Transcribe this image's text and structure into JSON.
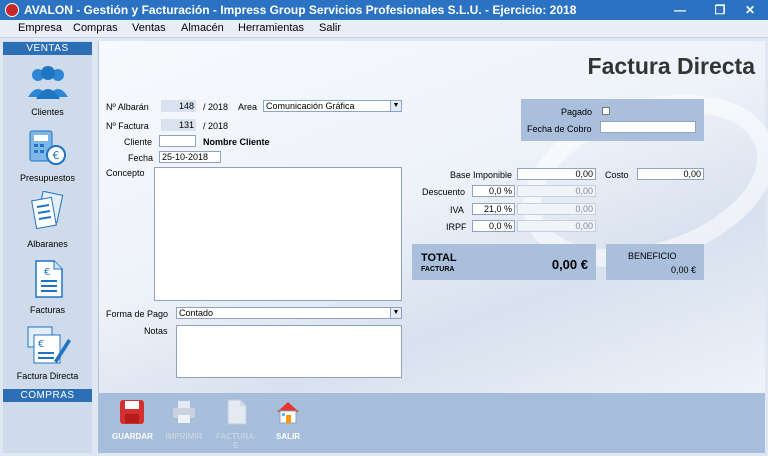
{
  "window": {
    "title": "AVALON - Gestión y Facturación - Impress Group Servicios Profesionales S.L.U. - Ejercicio: 2018",
    "minimize": "—",
    "restore": "❐",
    "close": "✕"
  },
  "menu": [
    "Empresa",
    "Compras",
    "Ventas",
    "Almacén",
    "Herramientas",
    "Salir"
  ],
  "sidebar": {
    "ventas_header": "VENTAS",
    "items": [
      {
        "label": "Clientes",
        "icon": "clients-icon"
      },
      {
        "label": "Presupuestos",
        "icon": "budget-icon"
      },
      {
        "label": "Albaranes",
        "icon": "delivery-notes-icon"
      },
      {
        "label": "Facturas",
        "icon": "invoices-icon"
      },
      {
        "label": "Factura Directa",
        "icon": "direct-invoice-icon"
      }
    ],
    "compras_header": "COMPRAS"
  },
  "form": {
    "title": "Factura Directa",
    "albaran_label": "Nº Albarán",
    "albaran_value": "148",
    "albaran_year": "/ 2018",
    "area_label": "Area",
    "area_value": "Comunicación Gráfica",
    "factura_label": "Nº Factura",
    "factura_value": "131",
    "factura_year": "/ 2018",
    "cliente_label": "Cliente",
    "cliente_value": "",
    "cliente_name": "Nombre Cliente",
    "fecha_label": "Fecha",
    "fecha_value": "25-10-2018",
    "concepto_label": "Concepto",
    "forma_pago_label": "Forma de Pago",
    "forma_pago_value": "Contado",
    "notas_label": "Notas"
  },
  "payment": {
    "pagado_label": "Pagado",
    "fecha_cobro_label": "Fecha de Cobro",
    "fecha_cobro_value": ""
  },
  "totals": {
    "base_label": "Base Imponible",
    "base_value": "0,00",
    "costo_label": "Costo",
    "costo_value": "0,00",
    "descuento_label": "Descuento",
    "descuento_pct": "0,0 %",
    "descuento_value": "0,00",
    "iva_label": "IVA",
    "iva_pct": "21,0 %",
    "iva_value": "0,00",
    "irpf_label": "IRPF",
    "irpf_pct": "0,0 %",
    "irpf_value": "0,00",
    "total_label": "TOTAL",
    "total_sub": "FACTURA",
    "total_value": "0,00 €",
    "beneficio_label": "BENEFICIO",
    "beneficio_value": "0,00 €"
  },
  "toolbar": [
    {
      "label": "GUARDAR",
      "icon": "floppy-disk-icon",
      "enabled": true
    },
    {
      "label": "IMPRIMIR",
      "icon": "printer-icon",
      "enabled": false
    },
    {
      "label": "FACTURA-E",
      "icon": "e-invoice-icon",
      "enabled": false
    },
    {
      "label": "SALIR",
      "icon": "home-exit-icon",
      "enabled": true
    }
  ],
  "colors": {
    "accent": "#2b73c2",
    "panel": "#a9bfdb",
    "save": "#d32f2f"
  }
}
